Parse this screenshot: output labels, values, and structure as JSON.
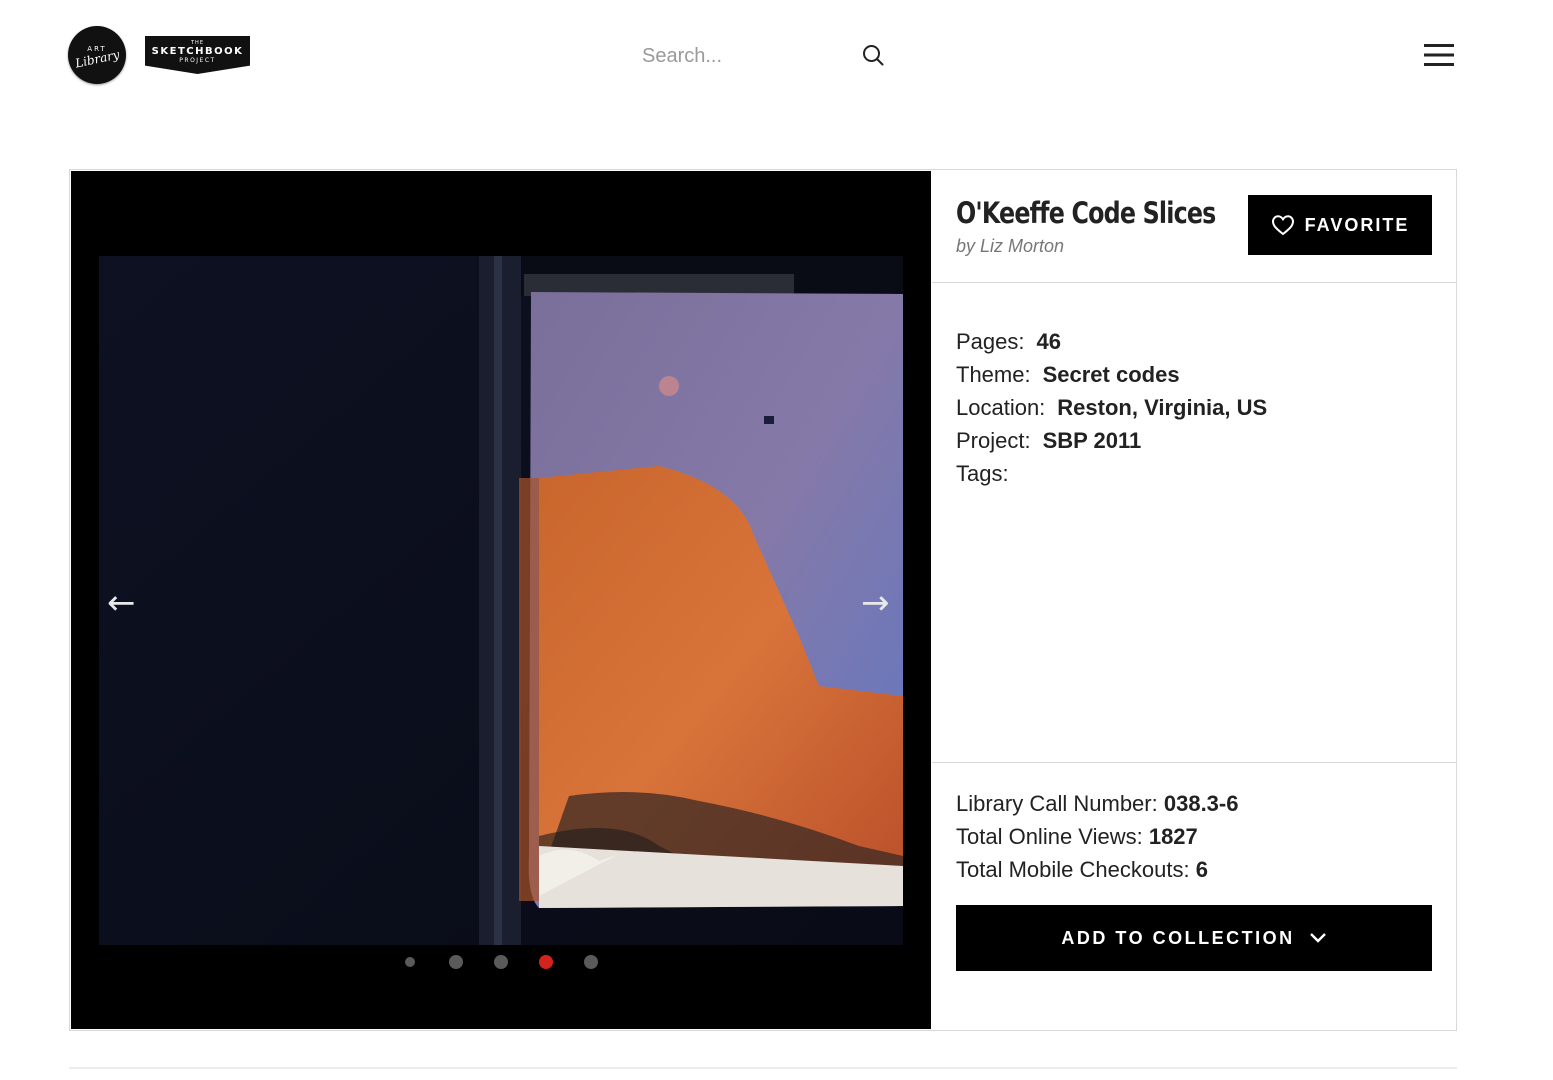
{
  "header": {
    "logo_art_library": {
      "line1": "ART",
      "line2": "Library"
    },
    "logo_sketchbook": {
      "the": "THE",
      "name": "SKETCHBOOK",
      "project": "PROJECT"
    },
    "search_placeholder": "Search...",
    "search_icon": "search-icon",
    "menu_icon": "hamburger-menu-icon"
  },
  "viewer": {
    "prev_arrow": "←",
    "next_arrow": "→",
    "page_count_dots": 5,
    "active_page_index": 3,
    "colors": {
      "active_dot": "#d2231c",
      "dot": "#5a5a5a"
    }
  },
  "book": {
    "title": "O'Keeffe Code Slices",
    "byline": "by Liz Morton",
    "favorite_label": "FAVORITE",
    "details": [
      {
        "label": "Pages:",
        "value": "46"
      },
      {
        "label": "Theme:",
        "value": "Secret codes"
      },
      {
        "label": "Location:",
        "value": "Reston, Virginia, US"
      },
      {
        "label": "Project:",
        "value": "SBP 2011"
      },
      {
        "label": "Tags:",
        "value": ""
      }
    ],
    "stats": [
      {
        "label": "Library Call Number:",
        "value": "038.3-6"
      },
      {
        "label": "Total Online Views:",
        "value": "1827"
      },
      {
        "label": "Total Mobile Checkouts:",
        "value": "6"
      }
    ],
    "add_to_collection_label": "ADD TO COLLECTION"
  }
}
